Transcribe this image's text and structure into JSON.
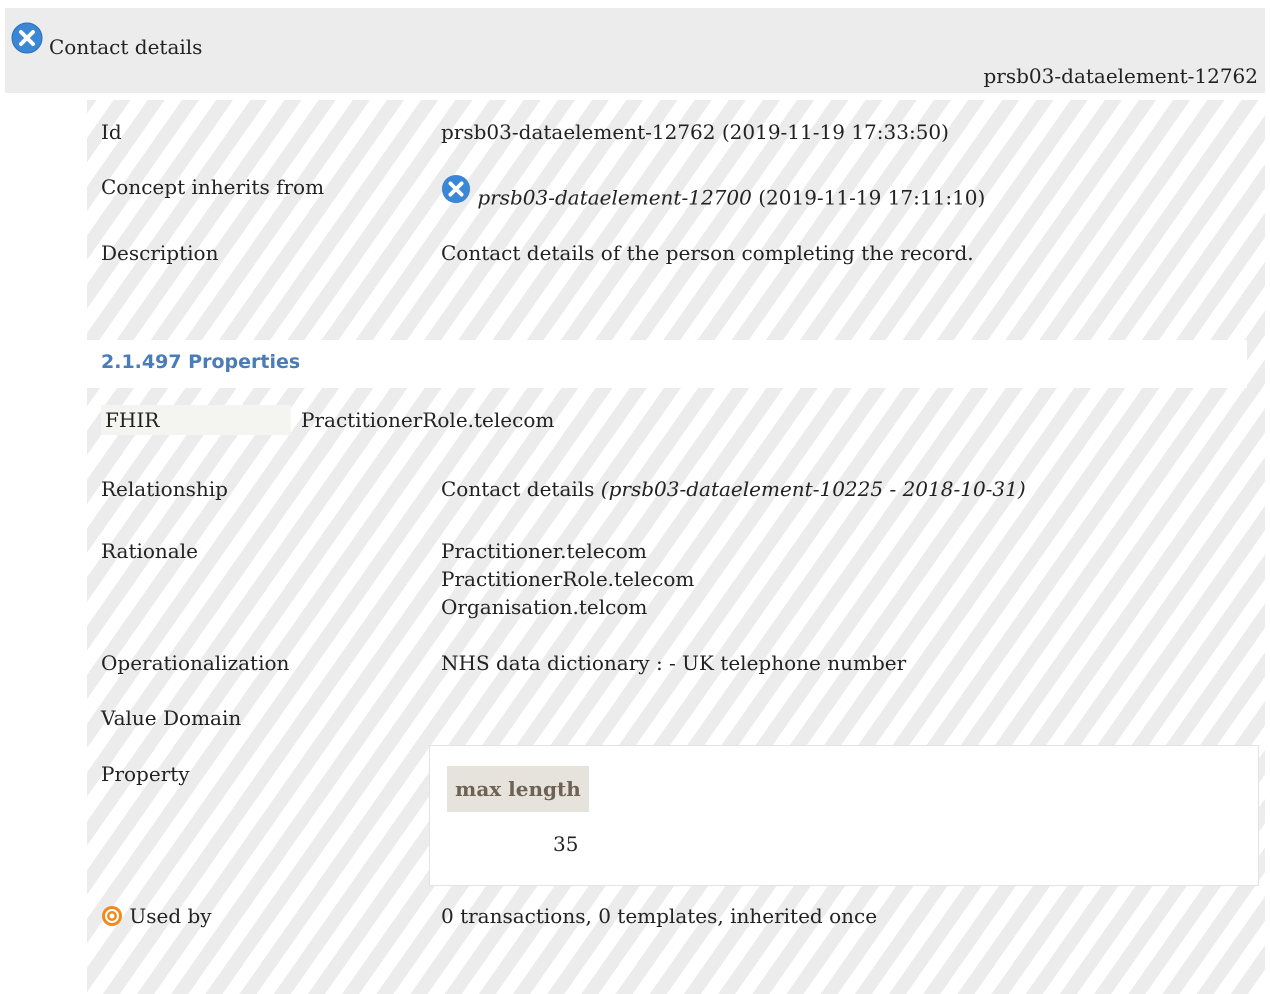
{
  "header": {
    "title": "Contact details",
    "id": "prsb03-dataelement-12762"
  },
  "rows": {
    "id": {
      "label": "Id",
      "value": "prsb03-dataelement-12762 (2019-11-19 17:33:50)"
    },
    "inherits": {
      "label": "Concept inherits from",
      "link": "prsb03-dataelement-12700",
      "date": "(2019-11-19 17:11:10)"
    },
    "description": {
      "label": "Description",
      "value": "Contact details of the person completing the record."
    }
  },
  "properties_heading": "2.1.497 Properties",
  "fhir": {
    "label": "FHIR",
    "value": "PractitionerRole.telecom"
  },
  "relationship": {
    "label": "Relationship",
    "value": "Contact details",
    "ref": "(prsb03-dataelement-10225 - 2018-10-31)"
  },
  "rationale": {
    "label": "Rationale",
    "lines": [
      "Practitioner.telecom",
      "PractitionerRole.telecom",
      "Organisation.telcom"
    ]
  },
  "operationalization": {
    "label": "Operationalization",
    "value": "NHS data dictionary : - UK telephone number"
  },
  "value_domain": {
    "label": "Value Domain"
  },
  "property": {
    "label": "Property",
    "key": "max length",
    "value": "35"
  },
  "used_by": {
    "label": "Used by",
    "value": "0 transactions, 0 templates, inherited once"
  },
  "colors": {
    "accent": "#4a7cb8",
    "icon_blue": "#3a87d6",
    "target_orange": "#f08a1c"
  },
  "icons": [
    "close-circle-icon",
    "target-icon"
  ]
}
